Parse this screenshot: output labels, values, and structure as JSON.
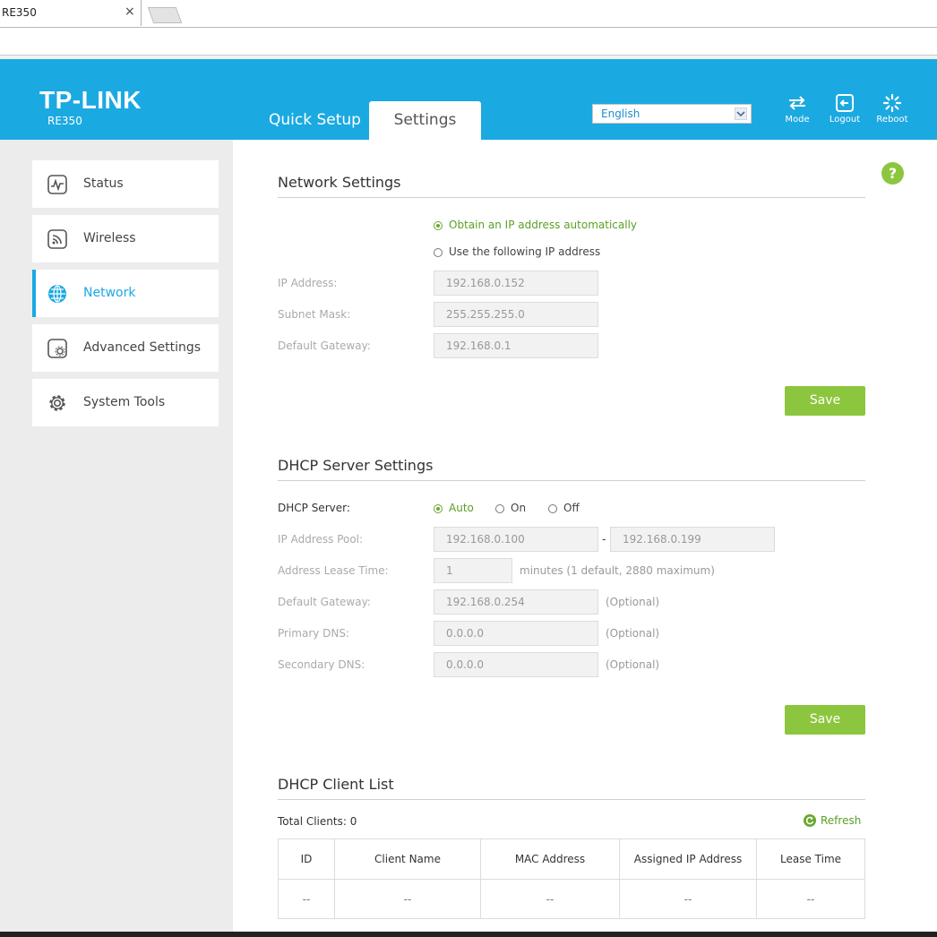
{
  "browser": {
    "tab_title": "RE350",
    "tab_close": "×"
  },
  "header": {
    "logo": "TP-LINK",
    "model": "RE350",
    "tabs": {
      "quick_setup": "Quick Setup",
      "settings": "Settings"
    },
    "language": "English",
    "buttons": {
      "mode": "Mode",
      "logout": "Logout",
      "reboot": "Reboot"
    },
    "colors": {
      "brand": "#1ba9e1",
      "accent": "#8cc63e"
    }
  },
  "sidebar": {
    "items": [
      {
        "label": "Status",
        "icon": "status-icon"
      },
      {
        "label": "Wireless",
        "icon": "wireless-icon"
      },
      {
        "label": "Network",
        "icon": "globe-icon",
        "active": true
      },
      {
        "label": "Advanced Settings",
        "icon": "advanced-settings-icon"
      },
      {
        "label": "System Tools",
        "icon": "gear-icon"
      }
    ]
  },
  "network": {
    "title": "Network Settings",
    "option_auto": "Obtain an IP address automatically",
    "option_static": "Use the following IP address",
    "ip_label": "IP Address:",
    "ip_value": "192.168.0.152",
    "mask_label": "Subnet Mask:",
    "mask_value": "255.255.255.0",
    "gateway_label": "Default Gateway:",
    "gateway_value": "192.168.0.1",
    "save": "Save"
  },
  "dhcp": {
    "title": "DHCP Server Settings",
    "server_label": "DHCP Server:",
    "opt_auto": "Auto",
    "opt_on": "On",
    "opt_off": "Off",
    "pool_label": "IP Address Pool:",
    "pool_start": "192.168.0.100",
    "pool_sep": "-",
    "pool_end": "192.168.0.199",
    "lease_label": "Address Lease Time:",
    "lease_value": "1",
    "lease_note": "minutes (1 default, 2880 maximum)",
    "gateway_label": "Default Gateway:",
    "gateway_value": "192.168.0.254",
    "primary_dns_label": "Primary DNS:",
    "primary_dns_value": "0.0.0.0",
    "secondary_dns_label": "Secondary DNS:",
    "secondary_dns_value": "0.0.0.0",
    "optional": "(Optional)",
    "save": "Save"
  },
  "clients": {
    "title": "DHCP Client List",
    "total": "Total Clients: 0",
    "refresh": "Refresh",
    "columns": [
      "ID",
      "Client Name",
      "MAC Address",
      "Assigned IP Address",
      "Lease Time"
    ],
    "row": [
      "--",
      "--",
      "--",
      "--",
      "--"
    ]
  }
}
